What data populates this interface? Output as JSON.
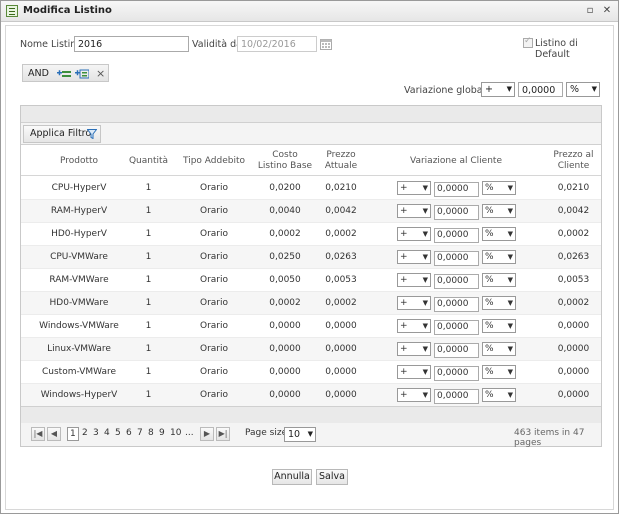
{
  "window": {
    "title": "Modifica Listino",
    "min_icon": "▫",
    "close_icon": "✕"
  },
  "form": {
    "nome_label": "Nome Listino",
    "nome_value": "2016",
    "validita_label": "Validità da",
    "validita_value": "10/02/2016",
    "default_label": "Listino di Default",
    "default_checked": true
  },
  "filter_ops": {
    "and_label": "AND",
    "remove": "×"
  },
  "variazione": {
    "label": "Variazione globale",
    "sign": "+",
    "value": "0,0000",
    "unit": "%"
  },
  "grid": {
    "filter_button": "Applica Filtro",
    "headers": {
      "prodotto": "Prodotto",
      "quantita": "Quantità",
      "tipo": "Tipo Addebito",
      "costo_1": "Costo",
      "costo_2": "Listino Base",
      "prezzo_1": "Prezzo",
      "prezzo_2": "Attuale",
      "variazione": "Variazione al Cliente",
      "prezzo_cliente_1": "Prezzo al",
      "prezzo_cliente_2": "Cliente"
    },
    "rows": [
      {
        "prodotto": "CPU-HyperV",
        "quantita": "1",
        "tipo": "Orario",
        "costo": "0,0200",
        "prezzo": "0,0210",
        "sign": "+",
        "val": "0,0000",
        "unit": "%",
        "cliente": "0,0210"
      },
      {
        "prodotto": "RAM-HyperV",
        "quantita": "1",
        "tipo": "Orario",
        "costo": "0,0040",
        "prezzo": "0,0042",
        "sign": "+",
        "val": "0,0000",
        "unit": "%",
        "cliente": "0,0042"
      },
      {
        "prodotto": "HD0-HyperV",
        "quantita": "1",
        "tipo": "Orario",
        "costo": "0,0002",
        "prezzo": "0,0002",
        "sign": "+",
        "val": "0,0000",
        "unit": "%",
        "cliente": "0,0002"
      },
      {
        "prodotto": "CPU-VMWare",
        "quantita": "1",
        "tipo": "Orario",
        "costo": "0,0250",
        "prezzo": "0,0263",
        "sign": "+",
        "val": "0,0000",
        "unit": "%",
        "cliente": "0,0263"
      },
      {
        "prodotto": "RAM-VMWare",
        "quantita": "1",
        "tipo": "Orario",
        "costo": "0,0050",
        "prezzo": "0,0053",
        "sign": "+",
        "val": "0,0000",
        "unit": "%",
        "cliente": "0,0053"
      },
      {
        "prodotto": "HD0-VMWare",
        "quantita": "1",
        "tipo": "Orario",
        "costo": "0,0002",
        "prezzo": "0,0002",
        "sign": "+",
        "val": "0,0000",
        "unit": "%",
        "cliente": "0,0002"
      },
      {
        "prodotto": "Windows-VMWare",
        "quantita": "1",
        "tipo": "Orario",
        "costo": "0,0000",
        "prezzo": "0,0000",
        "sign": "+",
        "val": "0,0000",
        "unit": "%",
        "cliente": "0,0000"
      },
      {
        "prodotto": "Linux-VMWare",
        "quantita": "1",
        "tipo": "Orario",
        "costo": "0,0000",
        "prezzo": "0,0000",
        "sign": "+",
        "val": "0,0000",
        "unit": "%",
        "cliente": "0,0000"
      },
      {
        "prodotto": "Custom-VMWare",
        "quantita": "1",
        "tipo": "Orario",
        "costo": "0,0000",
        "prezzo": "0,0000",
        "sign": "+",
        "val": "0,0000",
        "unit": "%",
        "cliente": "0,0000"
      },
      {
        "prodotto": "Windows-HyperV",
        "quantita": "1",
        "tipo": "Orario",
        "costo": "0,0000",
        "prezzo": "0,0000",
        "sign": "+",
        "val": "0,0000",
        "unit": "%",
        "cliente": "0,0000"
      }
    ]
  },
  "pager": {
    "pages": [
      "1",
      "2",
      "3",
      "4",
      "5",
      "6",
      "7",
      "8",
      "9",
      "10",
      "..."
    ],
    "page_size_label": "Page size:",
    "page_size_value": "10",
    "info": "463 items in 47 pages"
  },
  "footer": {
    "annulla": "Annulla",
    "salva": "Salva"
  }
}
